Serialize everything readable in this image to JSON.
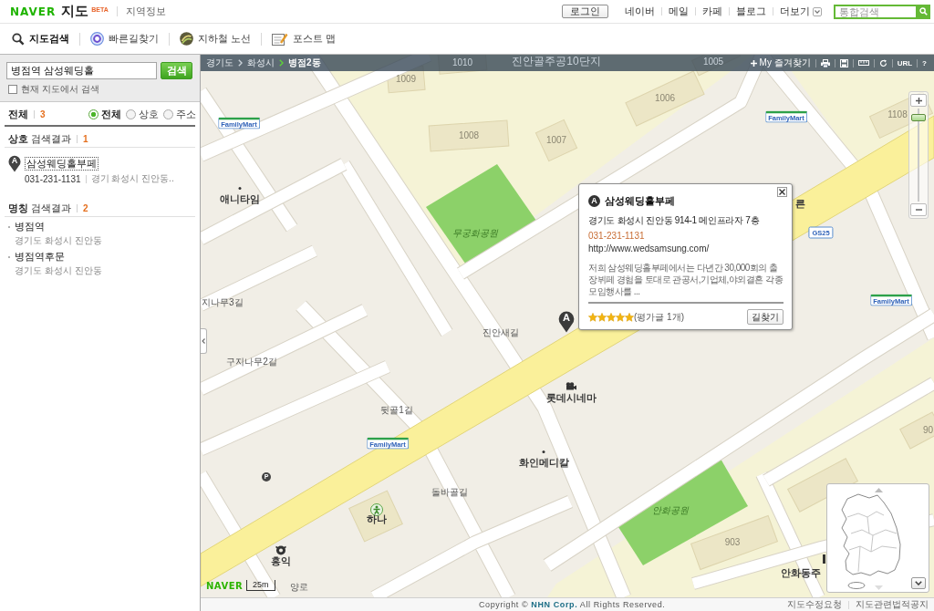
{
  "header": {
    "logo": "NAVER",
    "service": "지도",
    "badge": "BETA",
    "section": "지역정보",
    "login": "로그인",
    "links": [
      "네이버",
      "메일",
      "카페",
      "블로그"
    ],
    "more": "더보기",
    "search": {
      "placeholder": "통합검색"
    }
  },
  "tools": [
    {
      "kind": "search",
      "label": "지도검색",
      "selected": true
    },
    {
      "kind": "route",
      "label": "빠른길찾기",
      "selected": false
    },
    {
      "kind": "subway",
      "label": "지하철 노선",
      "selected": false
    },
    {
      "kind": "post",
      "label": "포스트 맵",
      "selected": false
    }
  ],
  "sidebar": {
    "search": {
      "value": "병점역 삼성웨딩홀",
      "button": "검색"
    },
    "map_only": {
      "label": "현재 지도에서 검색",
      "checked": false
    },
    "summary": {
      "label": "전체",
      "count": "3"
    },
    "filters": [
      {
        "label": "전체",
        "selected": true
      },
      {
        "label": "상호",
        "selected": false
      },
      {
        "label": "주소",
        "selected": false
      }
    ],
    "groups": [
      {
        "kind": "business",
        "title": "**상호** 검색결과",
        "count": "1",
        "items": [
          {
            "marker": "A",
            "name": "삼성웨딩홀부페",
            "focused": true,
            "phone": "031-231-1131",
            "address": "경기 화성시 진안동.."
          }
        ]
      },
      {
        "kind": "place",
        "title": "**명칭** 검색결과",
        "count": "2",
        "items": [
          {
            "name": "병점역",
            "address": "경기도 화성시 진안동"
          },
          {
            "name": "병점역후문",
            "address": "경기도 화성시 진안동"
          }
        ]
      }
    ]
  },
  "map": {
    "breadcrumb": [
      {
        "label": "경기도",
        "current": false
      },
      {
        "label": "화성시",
        "current": false
      },
      {
        "label": "병점2동",
        "current": true
      }
    ],
    "toolbar": [
      {
        "kind": "favorites",
        "label": "My 즐겨찾기"
      },
      {
        "kind": "print"
      },
      {
        "kind": "save"
      },
      {
        "kind": "measure"
      },
      {
        "kind": "refresh"
      },
      {
        "kind": "text",
        "label": "URL"
      },
      {
        "kind": "text",
        "label": "?"
      }
    ],
    "labels": [
      {
        "text": "1010",
        "kind": "building"
      },
      {
        "text": "진안골주공10단지",
        "kind": "complex"
      },
      {
        "text": "1005",
        "kind": "building"
      },
      {
        "text": "1009",
        "kind": "building"
      },
      {
        "text": "1006",
        "kind": "building"
      },
      {
        "text": "FamilyMart",
        "kind": "sign"
      },
      {
        "text": "FamilyMart",
        "kind": "sign"
      },
      {
        "text": "1108",
        "kind": "building"
      },
      {
        "text": "1008",
        "kind": "building"
      },
      {
        "text": "1007",
        "kind": "building"
      },
      {
        "text": "애니타임",
        "kind": "place"
      },
      {
        "text": "른",
        "kind": "place"
      },
      {
        "text": "무궁화공원",
        "kind": "park"
      },
      {
        "text": "GS25",
        "kind": "tag"
      },
      {
        "text": "지나무3길",
        "kind": "road"
      },
      {
        "text": "FamilyMart",
        "kind": "sign"
      },
      {
        "text": "진안새길",
        "kind": "road"
      },
      {
        "text": "구지나무2길",
        "kind": "road"
      },
      {
        "text": "롯데시네마",
        "kind": "place"
      },
      {
        "text": "뒷골1길",
        "kind": "road"
      },
      {
        "text": "90",
        "kind": "building"
      },
      {
        "text": "FamilyMart",
        "kind": "sign"
      },
      {
        "text": "화인메디칼",
        "kind": "place"
      },
      {
        "text": "P",
        "kind": "parking"
      },
      {
        "text": "돌바골길",
        "kind": "road"
      },
      {
        "text": "하나",
        "kind": "place"
      },
      {
        "text": "안화공원",
        "kind": "park"
      },
      {
        "text": "903",
        "kind": "building"
      },
      {
        "text": "홍익",
        "kind": "place"
      },
      {
        "text": "안화동주",
        "kind": "place"
      },
      {
        "text": "양로",
        "kind": "road"
      }
    ],
    "pins": [
      {
        "letter": "A"
      }
    ],
    "popup": {
      "marker": "A",
      "title": "삼성웨딩홀부페",
      "address": "경기도 화성시 진안동 914-1 메인프라자 7층",
      "phone": "031-231-1131",
      "url": "http://www.wedsamsung.com/",
      "description": "저희 삼성웨딩홀부페에서는 다년간 30,000회의 출장뷔페 경험을 토대로 관공서,기업체,야외결혼 각종 모임행사를 ...",
      "stars": 5,
      "reviews": "(평가글 1개)",
      "button": "길찾기"
    },
    "zoom": {
      "level": 0.93
    },
    "logo": "NAVER",
    "scale": "25m"
  },
  "footer": {
    "copyright": "Copyright © **NHN Corp.** All Rights Reserved.",
    "links": [
      "지도수정요청",
      "지도관련법적공지"
    ]
  }
}
